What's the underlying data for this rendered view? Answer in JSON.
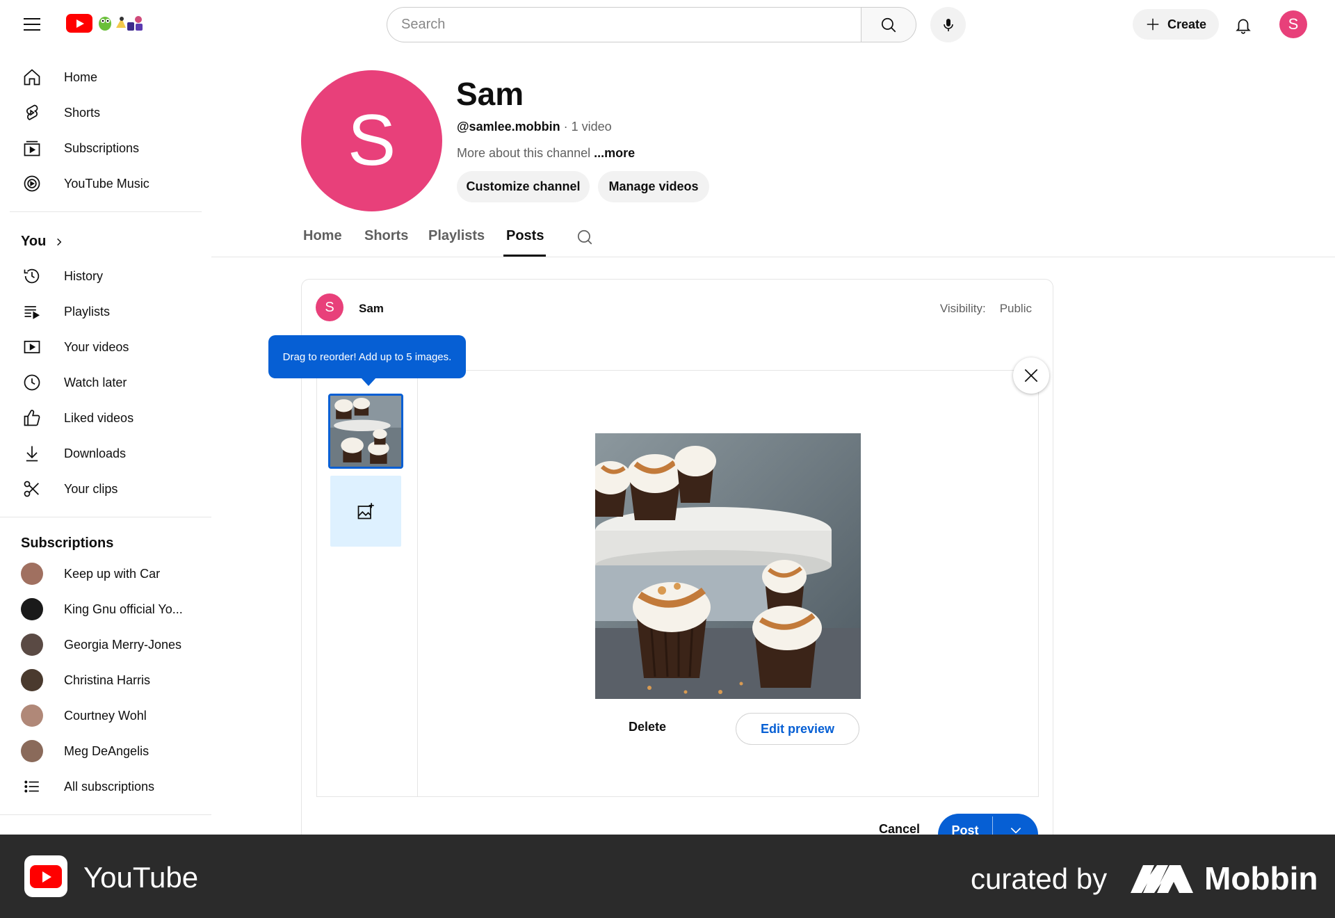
{
  "header": {
    "search_placeholder": "Search",
    "create_label": "Create",
    "avatar_letter": "S"
  },
  "sidebar": {
    "main": [
      {
        "label": "Home",
        "icon": "home-icon"
      },
      {
        "label": "Shorts",
        "icon": "shorts-icon"
      },
      {
        "label": "Subscriptions",
        "icon": "subscriptions-icon"
      },
      {
        "label": "YouTube Music",
        "icon": "youtube-music-icon"
      }
    ],
    "you_heading": "You",
    "you": [
      {
        "label": "History",
        "icon": "history-icon"
      },
      {
        "label": "Playlists",
        "icon": "playlists-icon"
      },
      {
        "label": "Your videos",
        "icon": "your-videos-icon"
      },
      {
        "label": "Watch later",
        "icon": "watch-later-icon"
      },
      {
        "label": "Liked videos",
        "icon": "liked-videos-icon"
      },
      {
        "label": "Downloads",
        "icon": "downloads-icon"
      },
      {
        "label": "Your clips",
        "icon": "clips-icon"
      }
    ],
    "subs_heading": "Subscriptions",
    "subs": [
      {
        "label": "Keep up with Car",
        "color": "#a07060"
      },
      {
        "label": "King Gnu official Yo...",
        "color": "#1a1a1a"
      },
      {
        "label": "Georgia Merry-Jones",
        "color": "#5a4a44"
      },
      {
        "label": "Christina Harris",
        "color": "#4a3a2e"
      },
      {
        "label": "Courtney Wohl",
        "color": "#b08878"
      },
      {
        "label": "Meg DeAngelis",
        "color": "#8a6a5a"
      }
    ],
    "all_subs": "All subscriptions"
  },
  "channel": {
    "avatar_letter": "S",
    "name": "Sam",
    "handle": "@samlee.mobbin",
    "video_count": "· 1 video",
    "about": "More about this channel",
    "more": "...more",
    "customize": "Customize channel",
    "manage": "Manage videos"
  },
  "tabs": [
    "Home",
    "Shorts",
    "Playlists",
    "Posts"
  ],
  "active_tab": "Posts",
  "post": {
    "avatar_letter": "S",
    "author": "Sam",
    "visibility_label": "Visibility:",
    "visibility_value": "Public",
    "tooltip": "Drag to reorder! Add up to 5 images.",
    "delete": "Delete",
    "edit_preview": "Edit preview",
    "cancel": "Cancel",
    "post": "Post"
  },
  "footer": {
    "brand": "YouTube",
    "curated": "curated by",
    "mobbin": "Mobbin"
  },
  "colors": {
    "accent": "#065fd4",
    "avatar": "#e8407a",
    "brand_red": "#ff0000",
    "footer_bg": "#2b2b2b"
  }
}
